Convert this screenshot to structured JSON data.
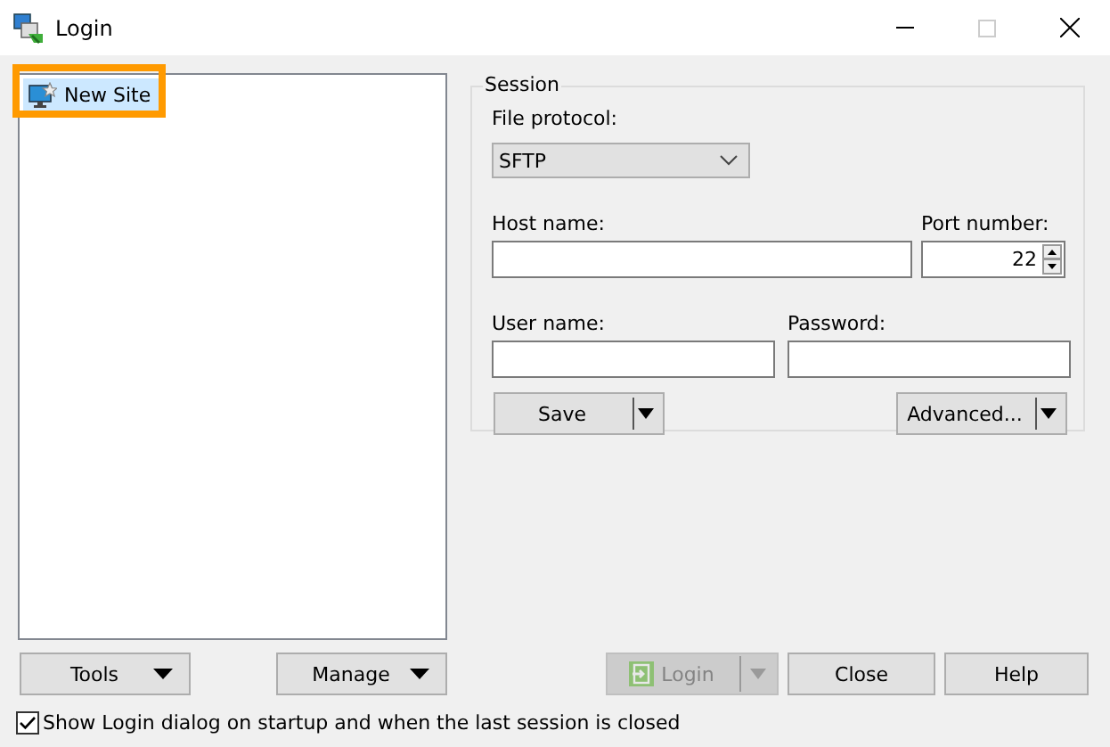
{
  "window": {
    "title": "Login"
  },
  "sites": [
    {
      "label": "New Site",
      "selected": true,
      "highlighted": true
    }
  ],
  "session": {
    "title": "Session",
    "file_protocol": {
      "label": "File protocol:",
      "value": "SFTP"
    },
    "host_name": {
      "label": "Host name:"
    },
    "port_number": {
      "label": "Port number:",
      "value": "22"
    },
    "user_name": {
      "label": "User name:"
    },
    "password": {
      "label": "Password:"
    },
    "buttons": [
      {
        "label": "Save",
        "kind": "split",
        "disabled": false
      },
      {
        "label": "Advanced...",
        "kind": "split",
        "disabled": false
      }
    ]
  },
  "left_buttons": [
    {
      "label": "Tools",
      "kind": "menu",
      "disabled": false
    },
    {
      "label": "Manage",
      "kind": "menu",
      "disabled": false
    }
  ],
  "buttons": [
    {
      "label": "Login",
      "kind": "login",
      "disabled": true
    },
    {
      "label": "Close",
      "kind": "plain",
      "disabled": false
    },
    {
      "label": "Help",
      "kind": "plain",
      "disabled": false
    }
  ],
  "show_on_startup": {
    "label": "Show Login dialog on startup and when the last session is closed",
    "checked": true
  }
}
